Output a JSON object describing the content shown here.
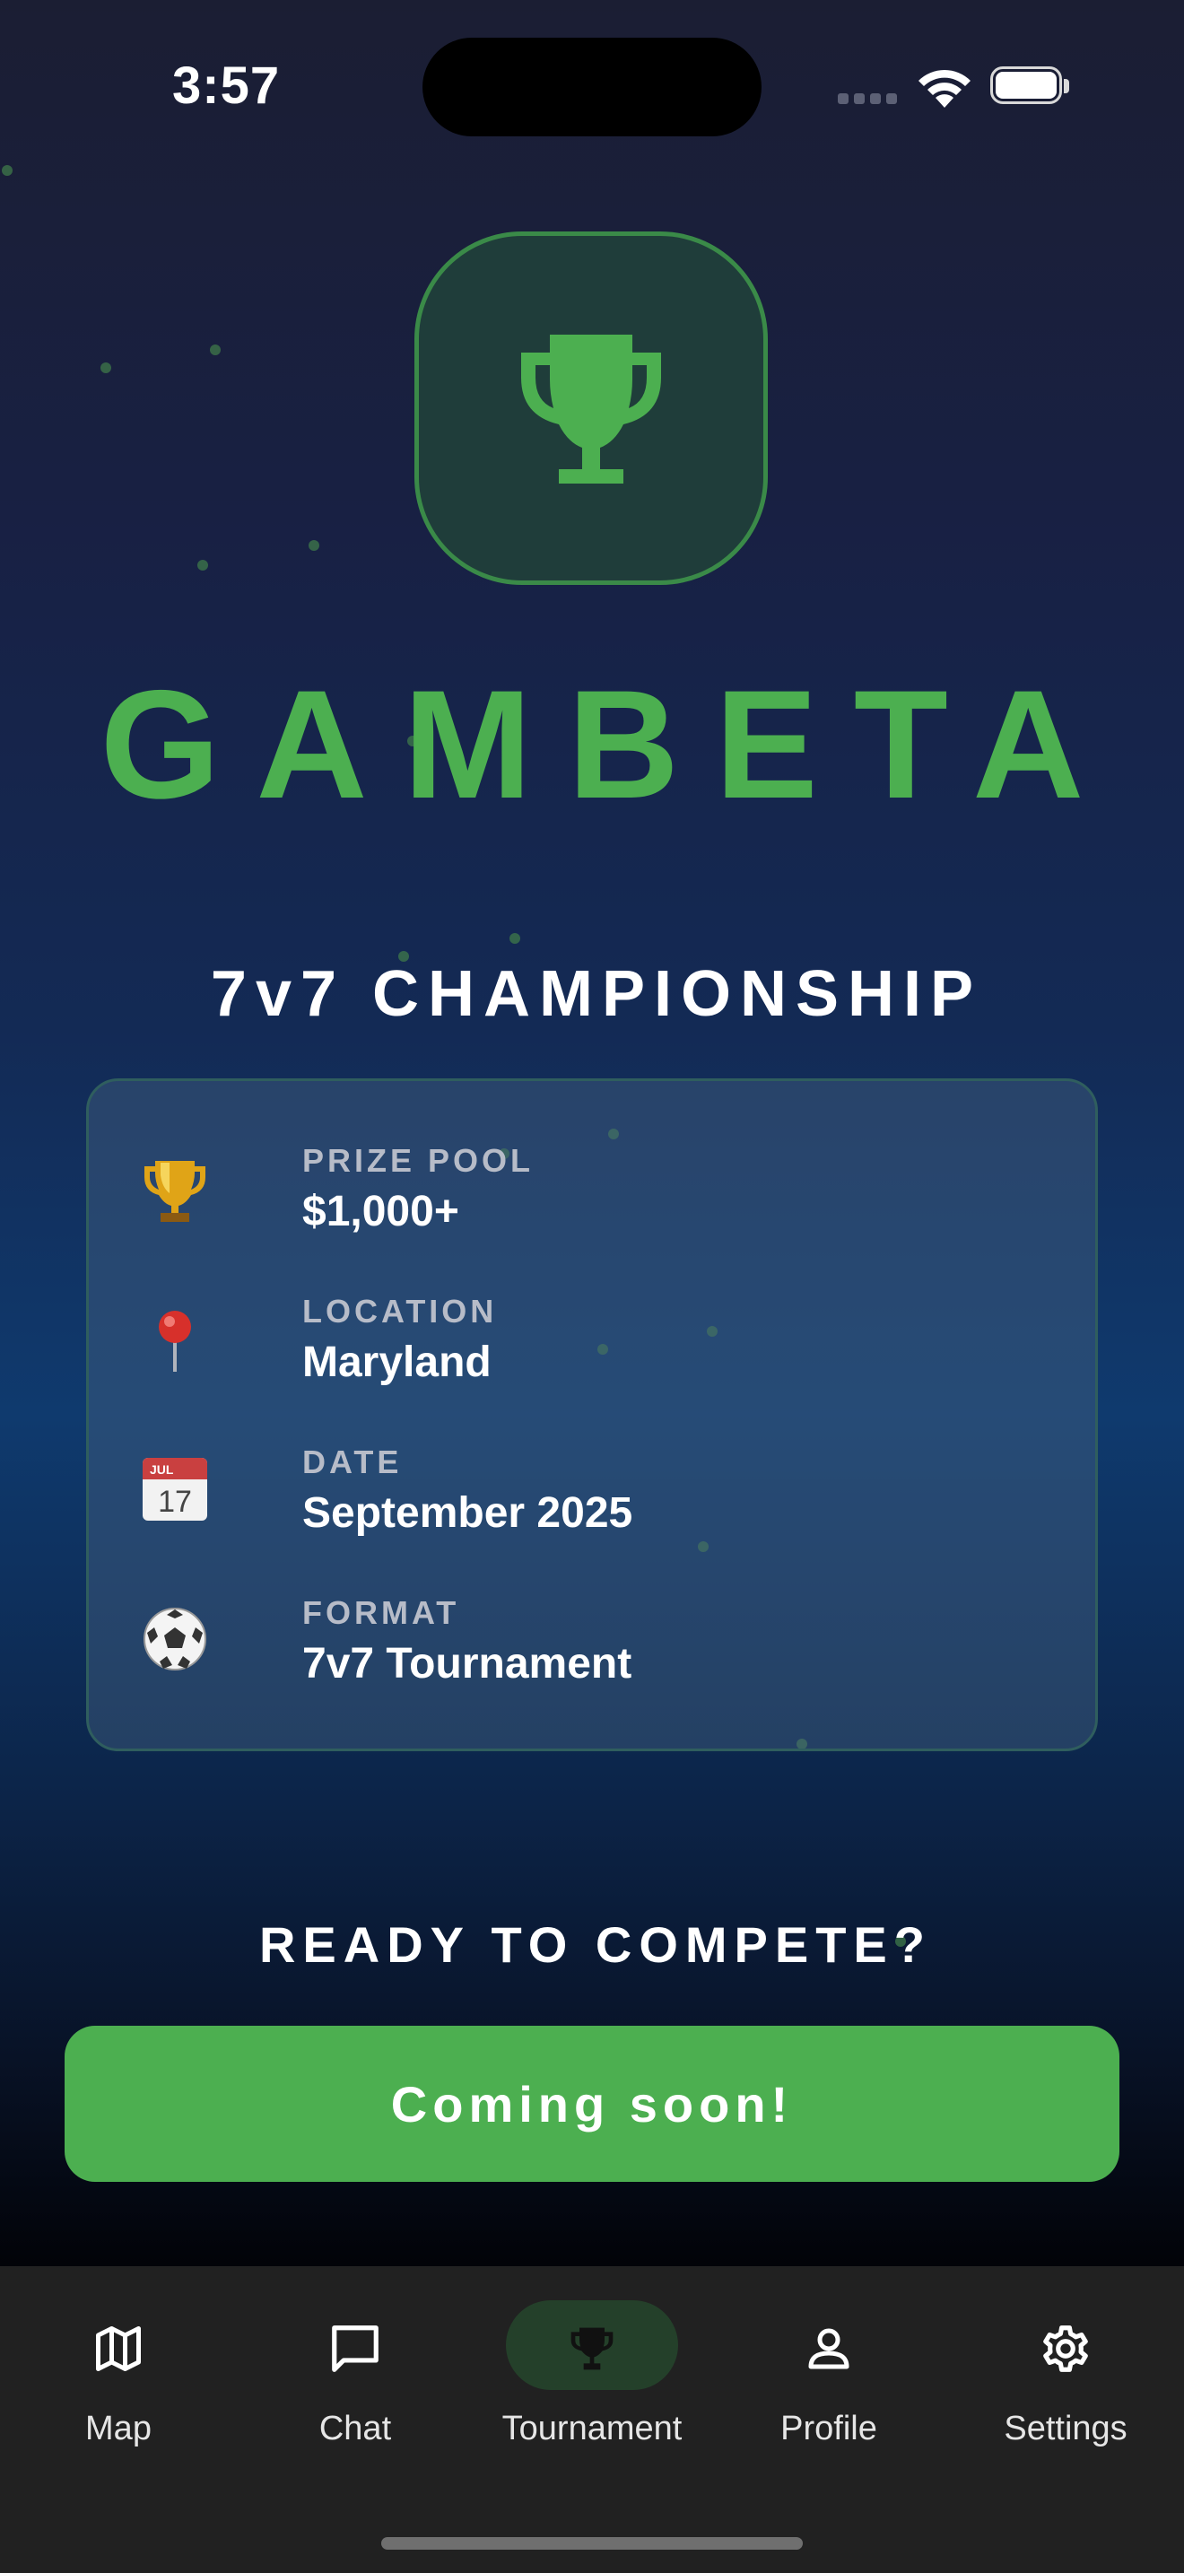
{
  "status_bar": {
    "time": "3:57"
  },
  "hero": {
    "logo_icon": "trophy-icon",
    "brand": "GAMBETA",
    "subtitle": "7v7 CHAMPIONSHIP",
    "accent_color": "#4caf50"
  },
  "info_card": {
    "items": [
      {
        "icon": "trophy-emoji",
        "label": "PRIZE POOL",
        "value": "$1,000+"
      },
      {
        "icon": "pushpin-emoji",
        "label": "LOCATION",
        "value": "Maryland"
      },
      {
        "icon": "calendar-emoji",
        "label": "DATE",
        "value": "September 2025"
      },
      {
        "icon": "soccer-ball-emoji",
        "label": "FORMAT",
        "value": "7v7 Tournament"
      }
    ]
  },
  "cta": {
    "heading": "READY TO COMPETE?",
    "button_label": "Coming soon!"
  },
  "tab_bar": {
    "active": "Tournament",
    "tabs": [
      {
        "label": "Map",
        "icon": "map-icon"
      },
      {
        "label": "Chat",
        "icon": "chat-bubble-icon"
      },
      {
        "label": "Tournament",
        "icon": "trophy-icon"
      },
      {
        "label": "Profile",
        "icon": "person-icon"
      },
      {
        "label": "Settings",
        "icon": "gear-icon"
      }
    ]
  }
}
